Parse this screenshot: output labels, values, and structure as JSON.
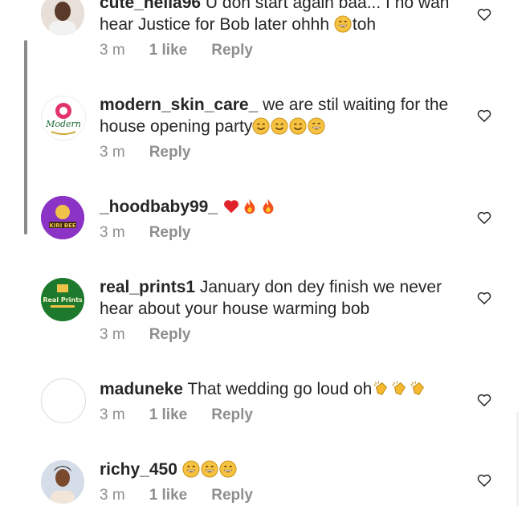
{
  "comments": [
    {
      "user": "cute_nella96",
      "text": "U don start again baa... I no wan hear Justice for Bob later ohhh",
      "suffix": "toh",
      "time": "3 m",
      "likes": "1 like",
      "reply": "Reply"
    },
    {
      "user": "modern_skin_care_",
      "text": "we are stil waiting for the house opening party",
      "time": "3 m",
      "reply": "Reply",
      "avatar_text": "Modern"
    },
    {
      "user": "_hoodbaby99_",
      "text": "",
      "time": "3 m",
      "reply": "Reply",
      "avatar_text": "KIRI BEE"
    },
    {
      "user": "real_prints1",
      "text": "January don dey finish we never hear about your house warming bob",
      "time": "3 m",
      "reply": "Reply",
      "avatar_text": "Real Prints"
    },
    {
      "user": "maduneke",
      "text": "That wedding go loud oh",
      "time": "3 m",
      "likes": "1 like",
      "reply": "Reply"
    },
    {
      "user": "richy_450",
      "text": "",
      "time": "3 m",
      "likes": "1 like",
      "reply": "Reply"
    }
  ],
  "icons": [
    "heart-icon",
    "grinning-emoji",
    "heart-emoji",
    "fire-emoji",
    "clap-emoji",
    "smile-emoji"
  ],
  "colors": {
    "text": "#262626",
    "meta": "#8e8e8e",
    "accent": "#e8b020"
  }
}
